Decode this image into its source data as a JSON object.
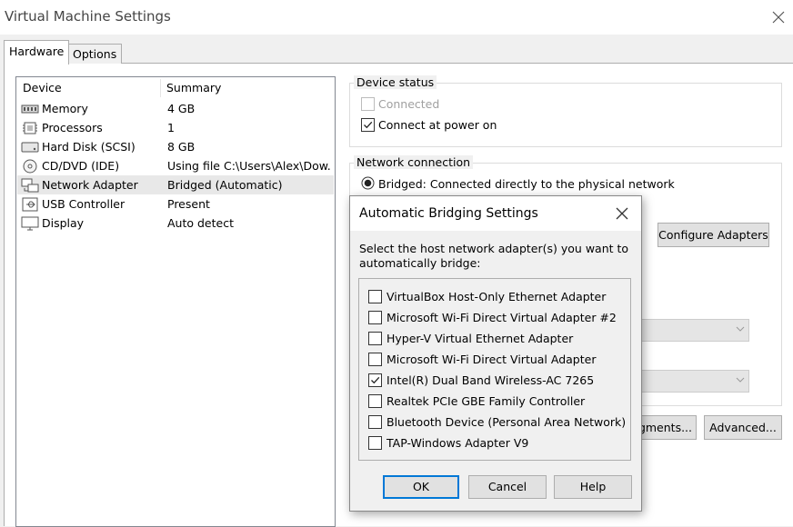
{
  "window": {
    "title": "Virtual Machine Settings"
  },
  "tabs": [
    {
      "label": "Hardware"
    },
    {
      "label": "Options"
    }
  ],
  "device_list": {
    "headers": {
      "device": "Device",
      "summary": "Summary"
    },
    "rows": [
      {
        "icon": "memory-icon",
        "name": "Memory",
        "summary": "4 GB"
      },
      {
        "icon": "processor-icon",
        "name": "Processors",
        "summary": "1"
      },
      {
        "icon": "hard-disk-icon",
        "name": "Hard Disk (SCSI)",
        "summary": "8 GB"
      },
      {
        "icon": "cd-dvd-icon",
        "name": "CD/DVD (IDE)",
        "summary": "Using file C:\\Users\\Alex\\Dow..."
      },
      {
        "icon": "network-adapter-icon",
        "name": "Network Adapter",
        "summary": "Bridged (Automatic)",
        "selected": true
      },
      {
        "icon": "usb-controller-icon",
        "name": "USB Controller",
        "summary": "Present"
      },
      {
        "icon": "display-icon",
        "name": "Display",
        "summary": "Auto detect"
      }
    ]
  },
  "device_status": {
    "title": "Device status",
    "connected_label": "Connected",
    "connected_checked": false,
    "connect_power_label": "Connect at power on",
    "connect_power_checked": true
  },
  "network_connection": {
    "title": "Network connection",
    "bridged_label": "Bridged: Connected directly to the physical network",
    "configure_adapters_label": "Configure Adapters"
  },
  "bottom_buttons": {
    "segments_label": "gments...",
    "advanced_label": "Advanced..."
  },
  "dialog": {
    "title": "Automatic Bridging Settings",
    "instruction": "Select the host network adapter(s) you want to automatically bridge:",
    "adapters": [
      {
        "label": "VirtualBox Host-Only Ethernet Adapter",
        "checked": false
      },
      {
        "label": "Microsoft Wi-Fi Direct Virtual Adapter #2",
        "checked": false
      },
      {
        "label": "Hyper-V Virtual Ethernet Adapter",
        "checked": false
      },
      {
        "label": "Microsoft Wi-Fi Direct Virtual Adapter",
        "checked": false
      },
      {
        "label": "Intel(R) Dual Band Wireless-AC 7265",
        "checked": true
      },
      {
        "label": "Realtek PCIe GBE Family Controller",
        "checked": false
      },
      {
        "label": "Bluetooth Device (Personal Area Network)",
        "checked": false
      },
      {
        "label": "TAP-Windows Adapter V9",
        "checked": false
      }
    ],
    "ok_label": "OK",
    "cancel_label": "Cancel",
    "help_label": "Help"
  },
  "colors": {
    "accent": "#0078d7",
    "selection": "#e8e8e8"
  }
}
